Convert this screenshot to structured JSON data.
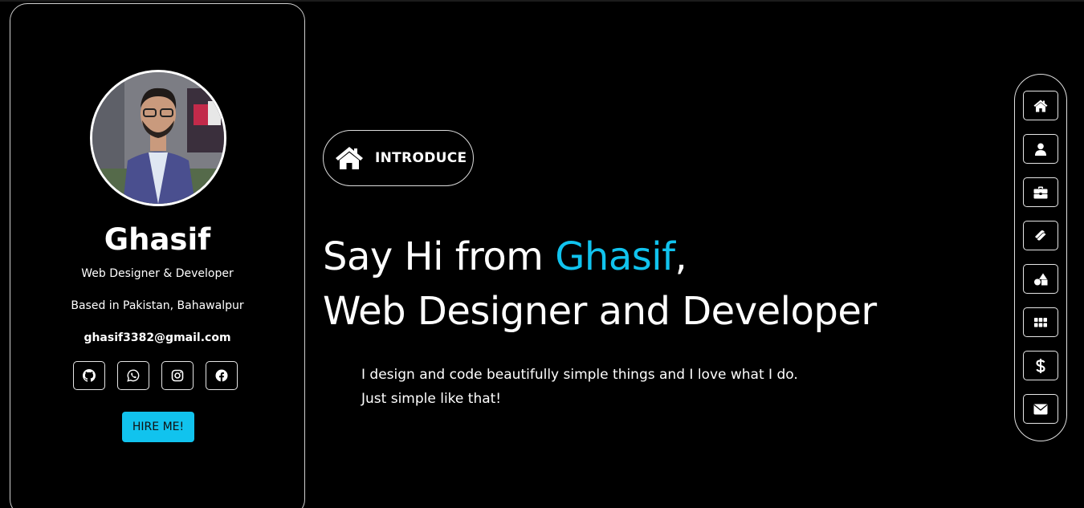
{
  "profile": {
    "name": "Ghasif",
    "role": "Web Designer & Developer",
    "location": "Based in Pakistan, Bahawalpur",
    "email": "ghasif3382@gmail.com",
    "hire_label": "HIRE ME!",
    "socials": [
      {
        "icon": "github-icon"
      },
      {
        "icon": "whatsapp-icon"
      },
      {
        "icon": "instagram-icon"
      },
      {
        "icon": "facebook-icon"
      }
    ]
  },
  "intro": {
    "pill_label": "INTRODUCE",
    "headline_prefix": "Say Hi from ",
    "headline_name": "Ghasif",
    "headline_comma": ",",
    "headline_line2": "Web Designer and Developer",
    "tagline_line1": "I design and code beautifully simple things and I love what I do.",
    "tagline_line2": "Just simple like that!"
  },
  "nav": {
    "items": [
      {
        "icon": "home-icon"
      },
      {
        "icon": "user-icon"
      },
      {
        "icon": "briefcase-icon"
      },
      {
        "icon": "layers-icon"
      },
      {
        "icon": "shapes-icon"
      },
      {
        "icon": "grid-icon"
      },
      {
        "icon": "dollar-icon"
      },
      {
        "icon": "envelope-icon"
      }
    ]
  },
  "colors": {
    "accent": "#11c3ee",
    "background": "#000000",
    "text": "#ffffff"
  }
}
